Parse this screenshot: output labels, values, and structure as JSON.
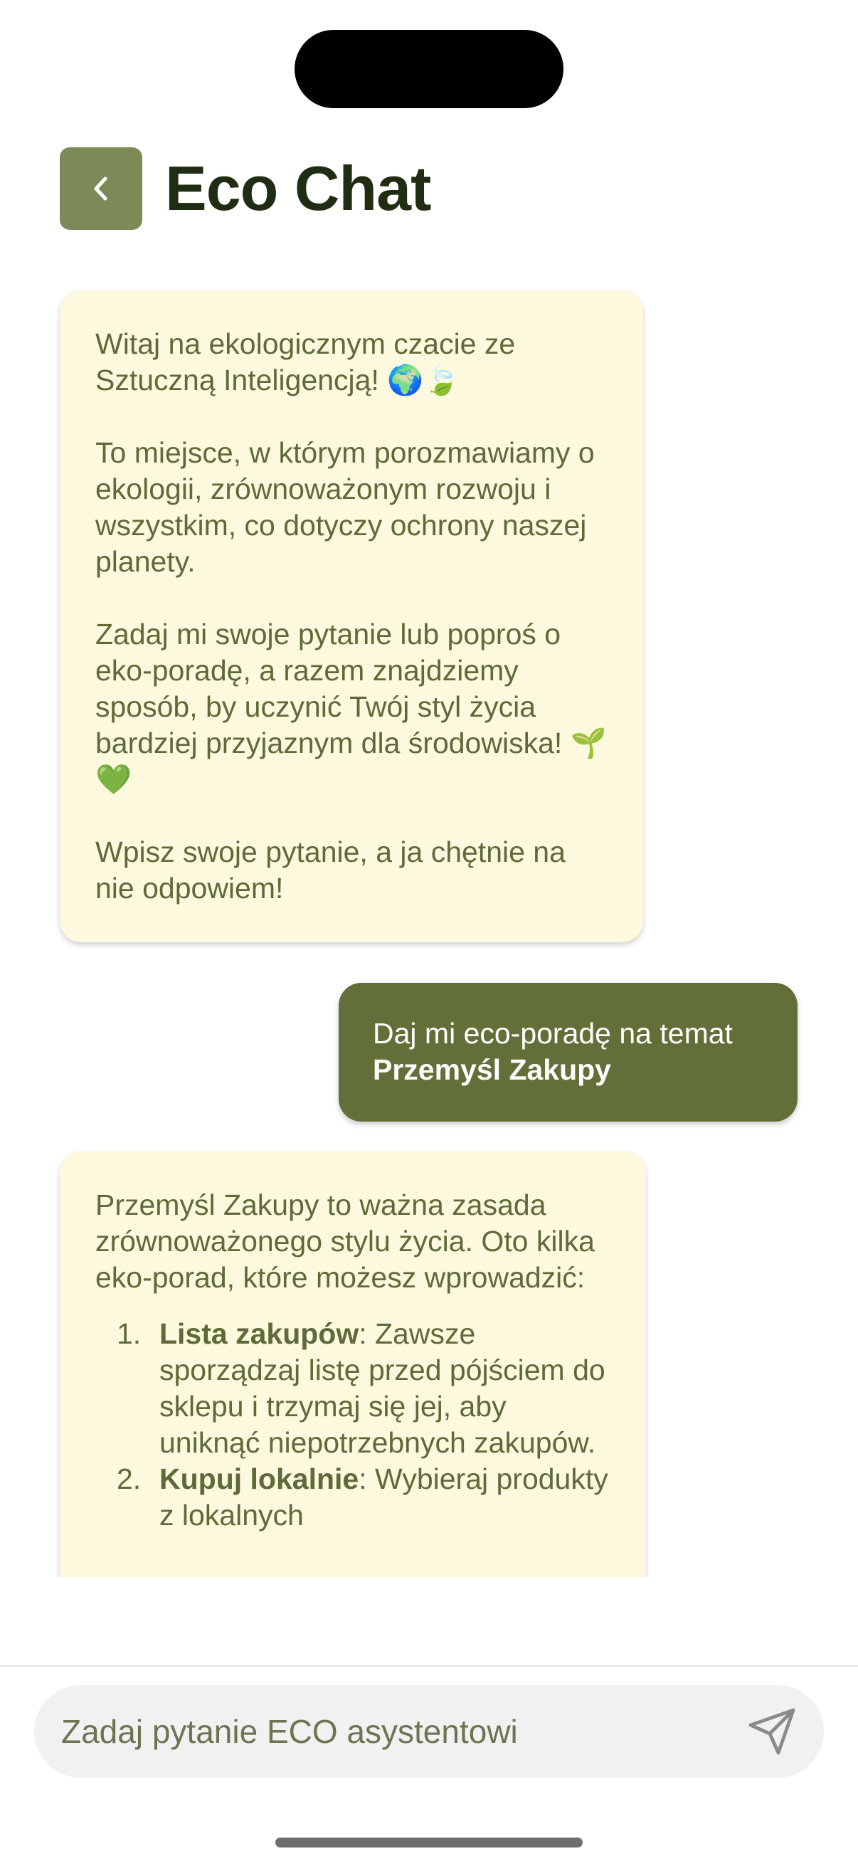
{
  "header": {
    "title": "Eco Chat"
  },
  "messages": {
    "welcome": {
      "p1": "Witaj na ekologicznym czacie ze Sztuczną Inteligencją! 🌍🍃",
      "p2": "To miejsce, w którym porozmawiamy o ekologii, zrównoważonym rozwoju i wszystkim, co dotyczy ochrony naszej planety.",
      "p3": "Zadaj mi swoje pytanie lub poproś o eko-poradę, a razem znajdziemy sposób, by uczynić Twój styl życia bardziej przyjaznym dla środowiska! 🌱💚",
      "p4": "Wpisz swoje pytanie, a ja chętnie na nie odpowiem!"
    },
    "user": {
      "prefix": "Daj mi eco-poradę na temat",
      "topic": "Przemyśl Zakupy"
    },
    "reply": {
      "intro": "Przemyśl Zakupy to ważna zasada zrównoważonego stylu życia. Oto kilka eko-porad, które możesz wprowadzić:",
      "tips": [
        {
          "num": "1.",
          "title": "Lista zakupów",
          "text": ": Zawsze sporządzaj listę przed pójściem do sklepu i trzymaj się jej, aby uniknąć niepotrzebnych zakupów."
        },
        {
          "num": "2.",
          "title": "Kupuj lokalnie",
          "text": ": Wybieraj produkty z lokalnych"
        }
      ]
    }
  },
  "input": {
    "placeholder": "Zadaj pytanie ECO asystentowi"
  },
  "colors": {
    "accent": "#636f38",
    "back_button": "#7b8a57",
    "bot_bubble": "#fcf9de",
    "bot_text": "#5e6a37",
    "title": "#1f2d12"
  },
  "icons": {
    "back": "chevron-left-icon",
    "send": "paper-plane-icon"
  }
}
